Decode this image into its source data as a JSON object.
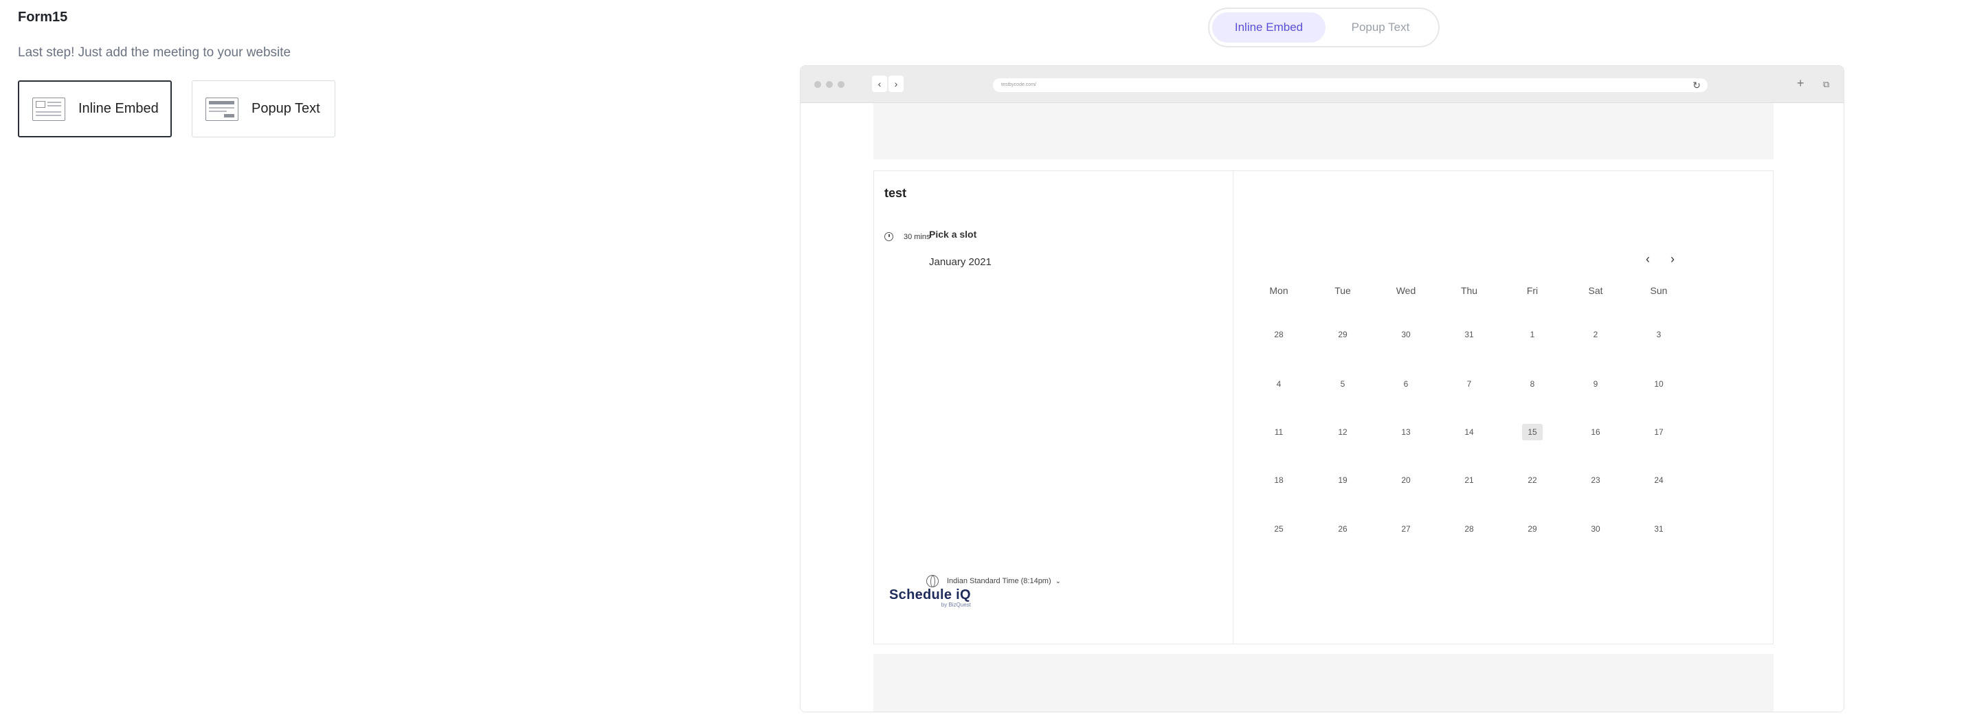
{
  "form": {
    "title": "Form15",
    "subtitle": "Last step! Just add the meeting to your website",
    "options": [
      {
        "label": "Inline Embed",
        "selected": true,
        "icon": "inline-embed-layout-icon"
      },
      {
        "label": "Popup Text",
        "selected": false,
        "icon": "popup-text-layout-icon"
      }
    ]
  },
  "preview_tabs": {
    "active": "Inline Embed",
    "inactive": "Popup Text"
  },
  "browser": {
    "url": "testbycode.com/",
    "icons": {
      "back": "chevron-left-icon",
      "forward": "chevron-right-icon",
      "reload": "reload-icon",
      "new_tab": "plus-icon",
      "window": "window-icon"
    }
  },
  "event": {
    "title": "test",
    "duration": "30 mins",
    "logo_main": "Schedule iQ",
    "logo_sub": "by BizQuest"
  },
  "calendar": {
    "heading": "Pick a slot",
    "month": "January 2021",
    "prev": "‹",
    "next": "›",
    "weekdays": [
      "Mon",
      "Tue",
      "Wed",
      "Thu",
      "Fri",
      "Sat",
      "Sun"
    ],
    "weeks": [
      [
        "28",
        "29",
        "30",
        "31",
        "1",
        "2",
        "3"
      ],
      [
        "4",
        "5",
        "6",
        "7",
        "8",
        "9",
        "10"
      ],
      [
        "11",
        "12",
        "13",
        "14",
        "15",
        "16",
        "17"
      ],
      [
        "18",
        "19",
        "20",
        "21",
        "22",
        "23",
        "24"
      ],
      [
        "25",
        "26",
        "27",
        "28",
        "29",
        "30",
        "31"
      ]
    ],
    "today": "15",
    "timezone": "Indian Standard Time (8:14pm)"
  }
}
